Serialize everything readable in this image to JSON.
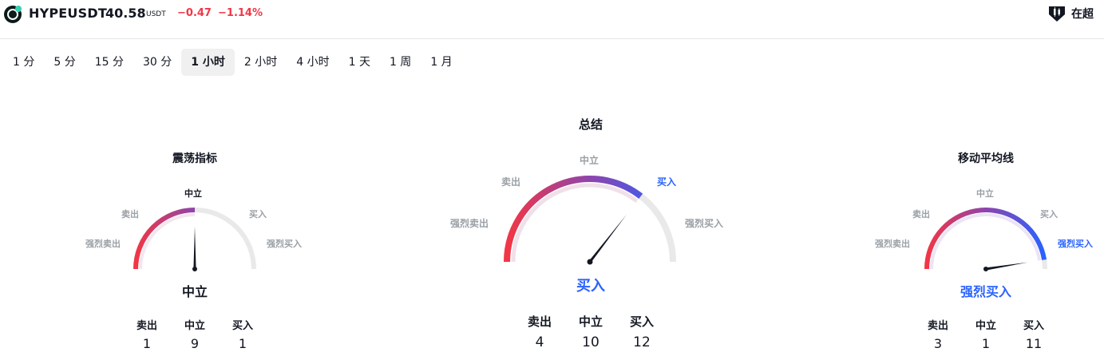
{
  "header": {
    "symbol": "HYPEUSDT",
    "price": "40.58",
    "quote_unit": "USDT",
    "change": "−0.47",
    "change_percent": "−1.14%",
    "right_label": "在超",
    "colors": {
      "negative": "#f23645",
      "buy": "#2962ff"
    }
  },
  "timeframes": [
    "1 分",
    "5 分",
    "15 分",
    "30 分",
    "1 小时",
    "2 小时",
    "4 小时",
    "1 天",
    "1 周",
    "1 月"
  ],
  "active_timeframe": "1 小时",
  "gauges": {
    "oscillators": {
      "title": "震荡指标",
      "labels": {
        "strong_sell": "强烈卖出",
        "sell": "卖出",
        "neutral": "中立",
        "buy": "买入",
        "strong_buy": "强烈买入"
      },
      "verdict": "中立",
      "needle_level": 0.5,
      "counts": [
        {
          "label": "卖出",
          "value": "1"
        },
        {
          "label": "中立",
          "value": "9"
        },
        {
          "label": "买入",
          "value": "1"
        }
      ]
    },
    "summary": {
      "title": "总结",
      "labels": {
        "strong_sell": "强烈卖出",
        "sell": "卖出",
        "neutral": "中立",
        "buy": "买入",
        "strong_buy": "强烈买入"
      },
      "verdict": "买入",
      "needle_level": 0.71,
      "counts": [
        {
          "label": "卖出",
          "value": "4"
        },
        {
          "label": "中立",
          "value": "10"
        },
        {
          "label": "买入",
          "value": "12"
        }
      ]
    },
    "moving_averages": {
      "title": "移动平均线",
      "labels": {
        "strong_sell": "强烈卖出",
        "sell": "卖出",
        "neutral": "中立",
        "buy": "买入",
        "strong_buy": "强烈买入"
      },
      "verdict": "强烈买入",
      "needle_level": 0.95,
      "counts": [
        {
          "label": "卖出",
          "value": "3"
        },
        {
          "label": "中立",
          "value": "1"
        },
        {
          "label": "买入",
          "value": "11"
        }
      ]
    }
  }
}
